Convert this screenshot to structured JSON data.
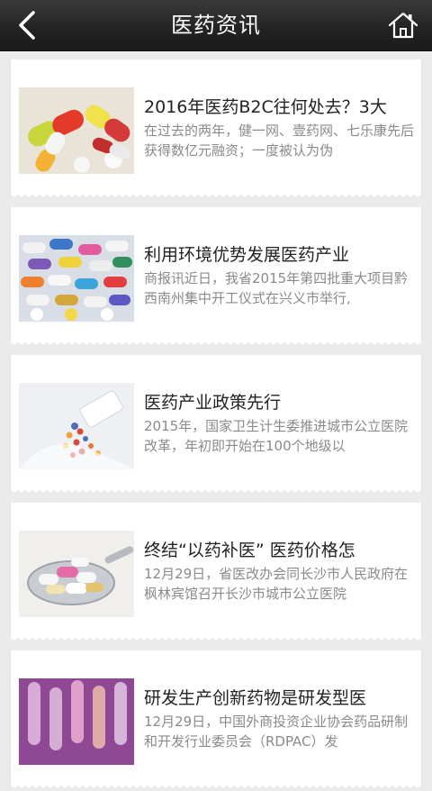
{
  "header": {
    "title": "医药资讯",
    "back_icon": "back-chevron-icon",
    "home_icon": "home-icon"
  },
  "articles": [
    {
      "title": "2016年医药B2C往何处去？3大",
      "summary": "在过去的两年，健一网、壹药网、七乐康先后获得数亿元融资；一度被认为伪",
      "thumb": "capsules-colorful"
    },
    {
      "title": "利用环境优势发展医药产业",
      "summary": "商报讯近日，我省2015年第四批重大项目黔西南州集中开工仪式在兴义市举行,",
      "thumb": "pills-pile"
    },
    {
      "title": "医药产业政策先行",
      "summary": "2015年，国家卫生计生委推进城市公立医院改革，年初即开始在100个地级以",
      "thumb": "pills-spilled-bottle"
    },
    {
      "title": "终结“以药补医” 医药价格怎",
      "summary": "12月29日，省医改办会同长沙市人民政府在枫林宾馆召开长沙市城市公立医院",
      "thumb": "pills-on-spoon"
    },
    {
      "title": "研发生产创新药物是研发型医",
      "summary": "12月29日，中国外商投资企业协会药品研制和开发行业委员会（RDPAC）发",
      "thumb": "test-tubes-purple"
    }
  ],
  "colors": {
    "header_bg": "#262626",
    "page_bg": "#ebebeb",
    "card_bg": "#ffffff",
    "title_text": "#222222",
    "summary_text": "#8a8a8a"
  }
}
